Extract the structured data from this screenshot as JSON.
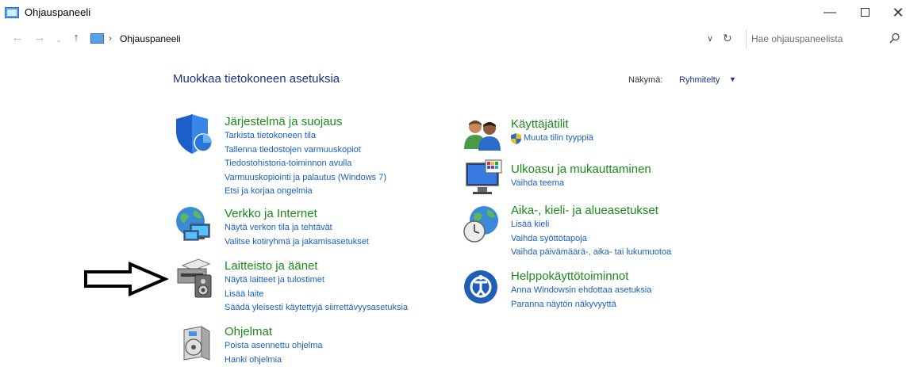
{
  "window": {
    "title": "Ohjauspaneeli",
    "minimize_glyph": "—",
    "close_glyph": "✕"
  },
  "nav": {
    "back_glyph": "←",
    "forward_glyph": "→",
    "recent_glyph": "⌄",
    "up_glyph": "↑",
    "breadcrumb_sep": "›",
    "breadcrumb": "Ohjauspaneeli",
    "dropdown_glyph": "∨",
    "refresh_glyph": "↻"
  },
  "search": {
    "placeholder": "Hae ohjauspaneelista"
  },
  "main": {
    "heading": "Muokkaa tietokoneen asetuksia",
    "view_label": "Näkymä:",
    "view_value": "Ryhmitelty",
    "view_arrow": "▼"
  },
  "categories": {
    "system": {
      "title": "Järjestelmä ja suojaus",
      "links": [
        "Tarkista tietokoneen tila",
        "Tallenna tiedostojen varmuuskopiot",
        "Tiedostohistoria-toiminnon avulla",
        "Varmuuskopiointi ja palautus (Windows 7)",
        "Etsi ja korjaa ongelmia"
      ]
    },
    "network": {
      "title": "Verkko ja Internet",
      "links": [
        "Näytä verkon tila ja tehtävät",
        "Valitse kotiryhmä ja jakamisasetukset"
      ]
    },
    "hardware": {
      "title": "Laitteisto ja äänet",
      "links": [
        "Näytä laitteet ja tulostimet",
        "Lisää laite",
        "Säädä yleisesti käytettyjä siirrettävyysasetuksia"
      ]
    },
    "programs": {
      "title": "Ohjelmat",
      "links": [
        "Poista asennettu ohjelma",
        "Hanki ohjelmia"
      ]
    },
    "users": {
      "title": "Käyttäjätilit",
      "links": [
        "Muuta tilin tyyppiä"
      ]
    },
    "appearance": {
      "title": "Ulkoasu ja mukauttaminen",
      "links": [
        "Vaihda teema"
      ]
    },
    "clock": {
      "title": "Aika-, kieli- ja alueasetukset",
      "links": [
        "Lisää kieli",
        "Vaihda syöttötapoja",
        "Vaihda päivämäärä-, aika- tai lukumuotoa"
      ]
    },
    "ease": {
      "title": "Helppokäyttötoiminnot",
      "links": [
        "Anna Windowsin ehdottaa asetuksia",
        "Paranna näytön näkyvyyttä"
      ]
    }
  },
  "colors": {
    "category_title": "#1a8a1a",
    "link": "#1a5fbf",
    "heading": "#1e3287"
  }
}
